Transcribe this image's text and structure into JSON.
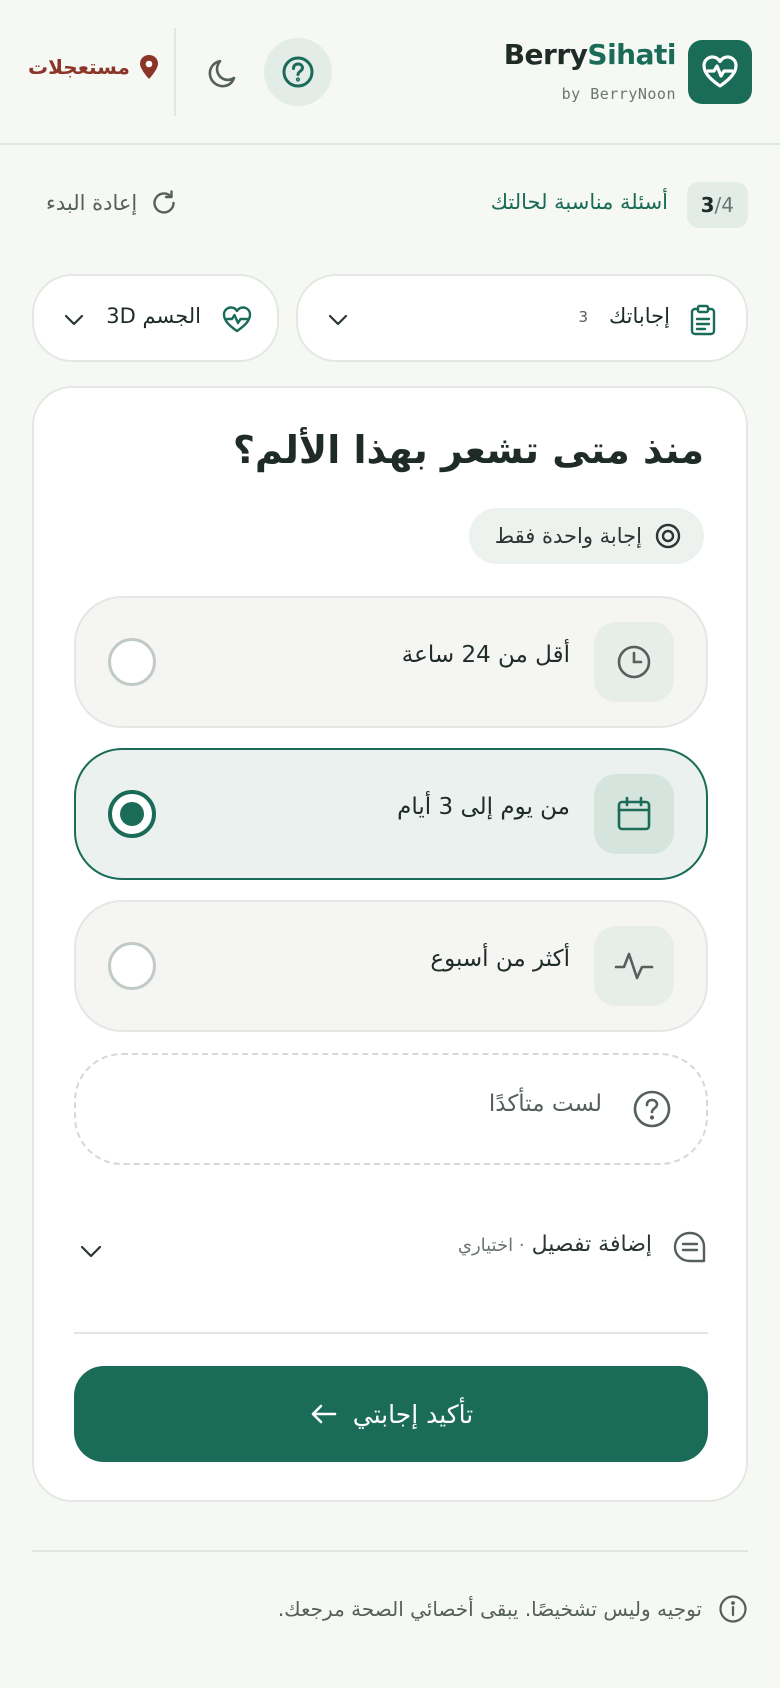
{
  "header": {
    "brand_primary": "Berry",
    "brand_accent": "Sihati",
    "brand_sub": "by BerryNoon",
    "urgent_label": "مستعجلات"
  },
  "progress": {
    "current": "3",
    "total": "/4",
    "title": "أسئلة مناسبة لحالتك",
    "restart_label": "إعادة البدء"
  },
  "selectors": {
    "answers_label": "إجاباتك",
    "answers_count": "3",
    "body_label": "الجسم 3D"
  },
  "question": {
    "title": "منذ متى تشعر بهذا الألم؟",
    "hint": "إجابة واحدة فقط",
    "options": [
      {
        "label": "أقل من 24 ساعة",
        "icon": "clock-icon",
        "selected": false
      },
      {
        "label": "من يوم إلى 3 أيام",
        "icon": "calendar-icon",
        "selected": true
      },
      {
        "label": "أكثر من أسبوع",
        "icon": "pulse-icon",
        "selected": false
      }
    ],
    "unsure_label": "لست متأكدًا",
    "detail_label": "إضافة تفصيل",
    "detail_optional": "· اختياري",
    "confirm_label": "تأكيد إجابتي"
  },
  "footer": {
    "disclaimer": "توجيه وليس تشخيصًا. يبقى أخصائي الصحة مرجعك."
  },
  "colors": {
    "primary": "#1a6b57",
    "urgent": "#8a3528",
    "background": "#f6f8f4"
  }
}
